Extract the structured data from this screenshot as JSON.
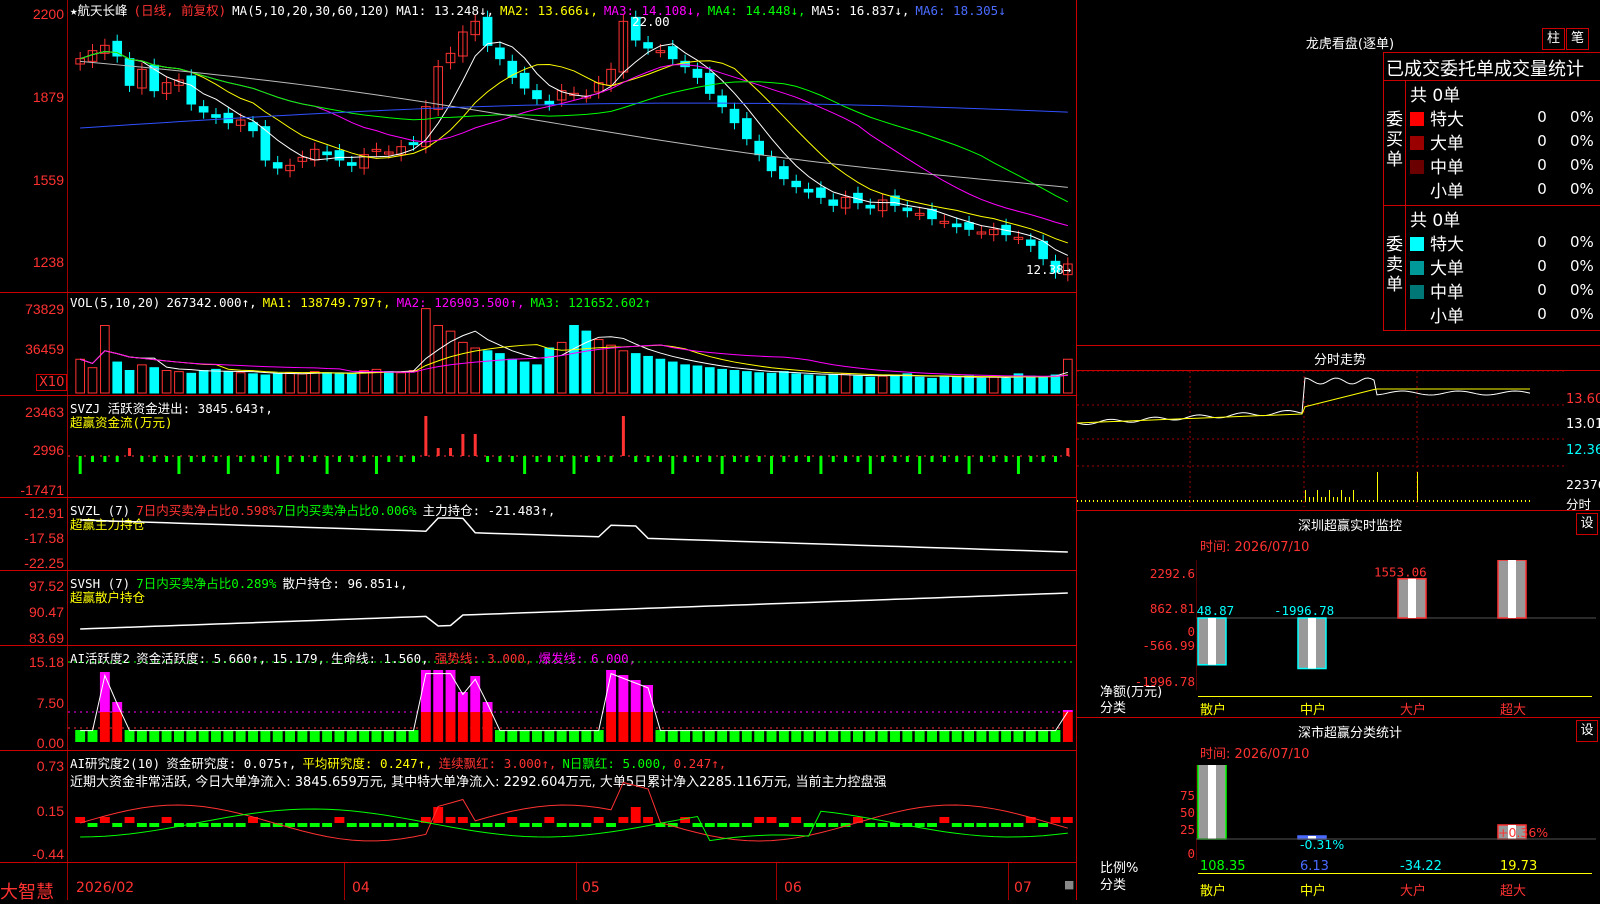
{
  "stock": {
    "name": "航天长峰",
    "star": "★",
    "mode": "(日线, 前复权)"
  },
  "main_ma": {
    "label": "MA(5,10,20,30,60,120)",
    "ma1": "MA1: 13.248↓,",
    "ma2": "MA2: 13.666↓,",
    "ma3": "MA3: 14.108↓,",
    "ma4": "MA4: 14.448↓,",
    "ma5": "MA5: 16.837↓,",
    "ma6": "MA6: 18.305↓"
  },
  "main_y": [
    "2200",
    "1879",
    "1559",
    "1238"
  ],
  "annot": {
    "high": "22.00",
    "low": "12.38→"
  },
  "vol": {
    "label": "VOL(5,10,20)",
    "value": "267342.000↑,",
    "ma1": "MA1: 138749.797↑,",
    "ma2": "MA2: 126903.500↑,",
    "ma3": "MA3: 121652.602↑",
    "y": [
      "73829",
      "36459"
    ],
    "x10": "X10"
  },
  "svzj": {
    "label": "SVZJ  活跃资金进出: 3845.643↑,",
    "sub": "超赢资金流(万元)",
    "y": [
      "23463",
      "2996",
      "-17471"
    ]
  },
  "svzl": {
    "label": "SVZL  (7)",
    "a": "7日内买卖净占比0.598%",
    "b": "7日内买卖净占比0.006%",
    "c": "主力持仓: -21.483↑,",
    "sub": "超赢主力持仓",
    "y": [
      "-12.91",
      "-17.58",
      "-22.25"
    ]
  },
  "svsh": {
    "label": "SVSH  (7)",
    "a": "7日内买卖净占比0.289%",
    "c": "散户持仓: 96.851↓,",
    "sub": "超赢散户持仓",
    "y": [
      "97.52",
      "90.47",
      "83.69"
    ]
  },
  "ai1": {
    "label": "AI活跃度2",
    "a": "资金活跃度: 5.660↑,",
    "b": "15.179,",
    "c": "生命线: 1.560,",
    "d": "强势线: 3.000,",
    "e": "爆发线: 6.000,",
    "y": [
      "15.18",
      "7.50",
      "0.00"
    ]
  },
  "ai2": {
    "label": "AI研究度2(10)",
    "a": "资金研究度: 0.075↑,",
    "b": "平均研究度: 0.247↑,",
    "c": "连续飘红: 3.000↑,",
    "d": "N日飘红: 5.000,",
    "e": "0.247↑,",
    "text": "近期大资金非常活跃, 今日大单净流入: 3845.659万元, 其中特大单净流入: 2292.604万元, 大单5日累计净入2285.116万元, 当前主力控盘强",
    "y": [
      "0.73",
      "0.15",
      "-0.44"
    ]
  },
  "xaxis": [
    "2026/02",
    "04",
    "05",
    "06",
    "07"
  ],
  "brand": "大智慧",
  "right": {
    "lhkp_title": "龙虎看盘(逐单)",
    "btn_zhu": "柱",
    "btn_bi": "笔",
    "ob_header": "已成交委托单成交量统计",
    "buy_label": "委买单",
    "sell_label": "委卖单",
    "buy_total": "共 0单",
    "sell_total": "共 0单",
    "rows_buy": [
      {
        "name": "特大",
        "val": "0",
        "pct": "0%",
        "color": "#ff0000"
      },
      {
        "name": "大单",
        "val": "0",
        "pct": "0%",
        "color": "#9b0000"
      },
      {
        "name": "中单",
        "val": "0",
        "pct": "0%",
        "color": "#6b0000"
      },
      {
        "name": "小单",
        "val": "0",
        "pct": "0%",
        "color": ""
      }
    ],
    "rows_sell": [
      {
        "name": "特大",
        "val": "0",
        "pct": "0%",
        "color": "#00ffff"
      },
      {
        "name": "大单",
        "val": "0",
        "pct": "0%",
        "color": "#009999"
      },
      {
        "name": "中单",
        "val": "0",
        "pct": "0%",
        "color": "#007777"
      },
      {
        "name": "小单",
        "val": "0",
        "pct": "0%",
        "color": ""
      }
    ],
    "fs_title": "分时走势",
    "fs_y": [
      "13.60",
      "13.01",
      "12.36",
      "22376"
    ],
    "fs_unit": "分时",
    "sz_title": "深圳超赢实时监控",
    "sz_btn": "设",
    "time_label": "时间: 2026/07/10",
    "sz_y": [
      "2292.6",
      "862.81",
      "0",
      "-566.99",
      "-1996.78"
    ],
    "sz_ylabel": "净额(万元)",
    "sz_xcat": "分类",
    "sz_vals": [
      "-1848.87",
      "-1996.78",
      "1553.06",
      "2292.6"
    ],
    "cats": [
      "散户",
      "中户",
      "大户",
      "超大"
    ],
    "cl_title": "深市超赢分类统计",
    "cl_btn": "设",
    "cl_y": [
      "75",
      "50",
      "25",
      "0"
    ],
    "cl_ylabel": "比例%",
    "cl_xcat": "分类",
    "cl_top": [
      "-0.31%",
      "+0.36%"
    ],
    "cl_vals": [
      "108.35",
      "6.13",
      "-34.22",
      "19.73"
    ]
  },
  "chart_data": {
    "type": "candlestick",
    "ylim": [
      12.0,
      22.5
    ],
    "closes": [
      20.6,
      20.9,
      21.1,
      20.7,
      19.6,
      20.2,
      19.4,
      19.7,
      19.8,
      18.9,
      18.6,
      18.4,
      18.2,
      18.3,
      17.9,
      16.8,
      16.5,
      16.6,
      16.9,
      17.2,
      17.0,
      16.8,
      16.6,
      17.0,
      17.2,
      17.1,
      17.3,
      17.4,
      18.8,
      20.3,
      20.8,
      21.6,
      22.0,
      21.1,
      20.6,
      19.9,
      19.5,
      19.1,
      18.9,
      19.4,
      19.3,
      19.2,
      19.7,
      20.2,
      22.0,
      21.3,
      21.0,
      20.9,
      20.6,
      20.3,
      19.9,
      19.3,
      18.8,
      18.2,
      17.6,
      17.0,
      16.4,
      16.1,
      15.8,
      15.6,
      15.4,
      15.1,
      15.4,
      15.2,
      15.0,
      15.3,
      15.1,
      14.9,
      14.8,
      14.6,
      14.5,
      14.3,
      14.2,
      14.1,
      14.2,
      14.0,
      13.9,
      13.6,
      13.1,
      12.6,
      12.9
    ],
    "vol": [
      60,
      45,
      120,
      55,
      40,
      50,
      45,
      40,
      38,
      35,
      40,
      42,
      38,
      36,
      34,
      32,
      35,
      36,
      34,
      38,
      36,
      35,
      34,
      40,
      42,
      38,
      36,
      40,
      150,
      120,
      110,
      90,
      80,
      75,
      70,
      60,
      55,
      50,
      80,
      90,
      120,
      110,
      95,
      85,
      75,
      70,
      65,
      60,
      55,
      50,
      48,
      45,
      42,
      40,
      38,
      36,
      35,
      38,
      34,
      32,
      30,
      32,
      34,
      30,
      28,
      30,
      32,
      34,
      28,
      26,
      30,
      28,
      30,
      26,
      28,
      26,
      34,
      30,
      28,
      32,
      60
    ]
  }
}
